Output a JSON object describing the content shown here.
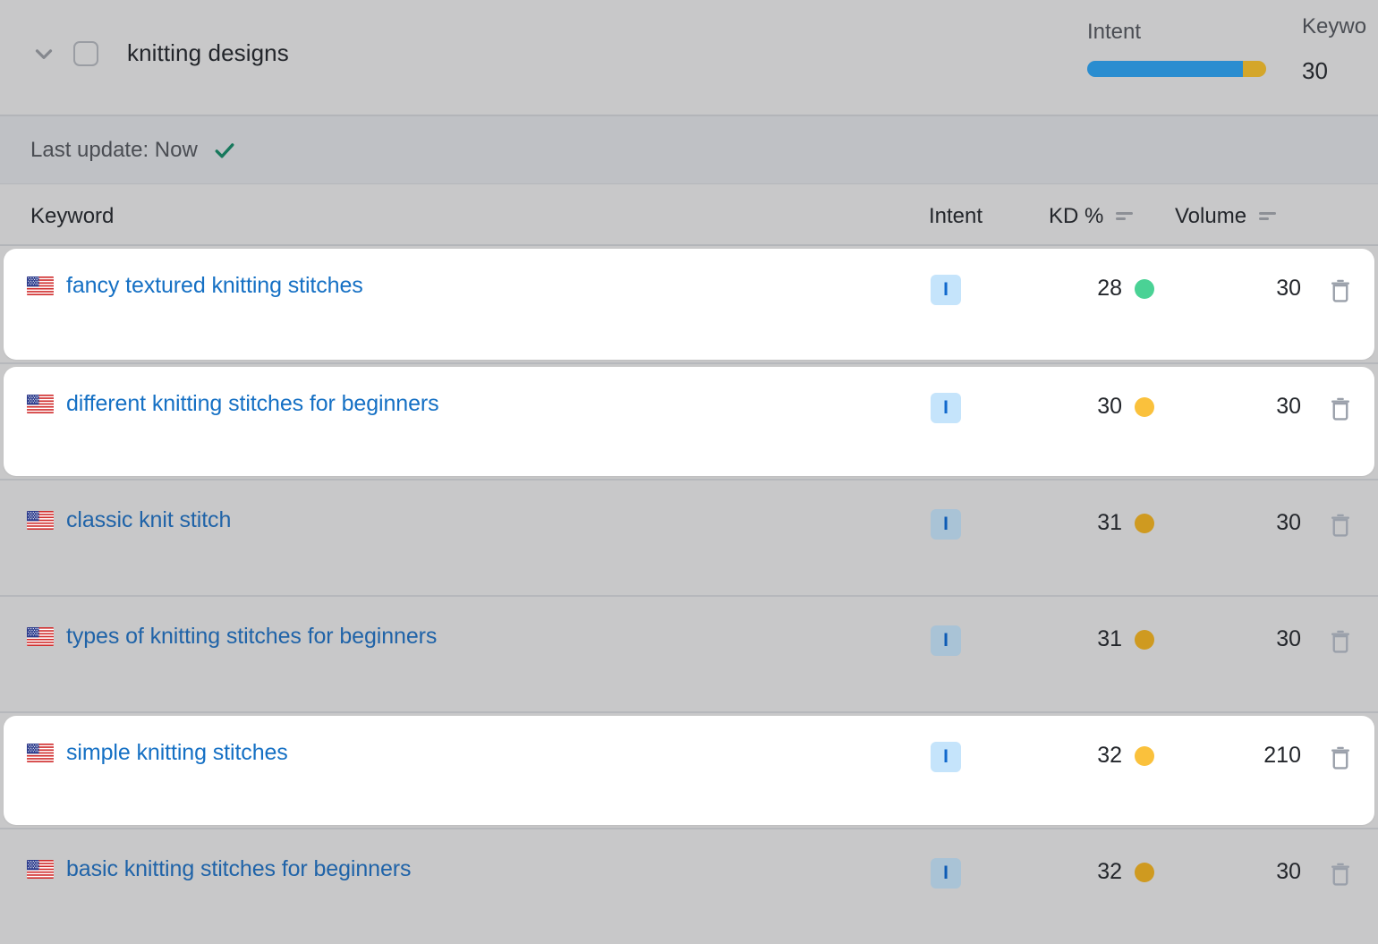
{
  "group_header": {
    "chevron_icon": "chevron-down-icon",
    "checkbox_checked": false,
    "title": "knitting designs",
    "intent_label": "Intent",
    "intent_segments": [
      {
        "name": "informational",
        "color": "#2a8dd0",
        "percent": 87
      },
      {
        "name": "commercial",
        "color": "#d4a62a",
        "percent": 13
      }
    ],
    "keywords_label": "Keywo",
    "keywords_value": "30"
  },
  "status_bar": {
    "text": "Last update: Now",
    "check_icon": "check-icon",
    "check_color": "#17785c"
  },
  "table": {
    "columns": [
      {
        "key": "keyword",
        "label": "Keyword",
        "sortable": false
      },
      {
        "key": "intent",
        "label": "Intent",
        "sortable": false
      },
      {
        "key": "kd",
        "label": "KD %",
        "sortable": true
      },
      {
        "key": "volume",
        "label": "Volume",
        "sortable": true
      }
    ],
    "rows": [
      {
        "flag": "us-flag-icon",
        "keyword": "fancy textured knitting stitches",
        "intent": "I",
        "kd": "28",
        "kd_color": "#4ad295",
        "volume": "30",
        "highlighted": true
      },
      {
        "flag": "us-flag-icon",
        "keyword": "different knitting stitches for beginners",
        "intent": "I",
        "kd": "30",
        "kd_color": "#fac13c",
        "volume": "30",
        "highlighted": true
      },
      {
        "flag": "us-flag-icon",
        "keyword": "classic knit stitch",
        "intent": "I",
        "kd": "31",
        "kd_color": "#cf9a20",
        "volume": "30",
        "highlighted": false
      },
      {
        "flag": "us-flag-icon",
        "keyword": "types of knitting stitches for beginners",
        "intent": "I",
        "kd": "31",
        "kd_color": "#cf9a20",
        "volume": "30",
        "highlighted": false
      },
      {
        "flag": "us-flag-icon",
        "keyword": "simple knitting stitches",
        "intent": "I",
        "kd": "32",
        "kd_color": "#fac13c",
        "volume": "210",
        "highlighted": true
      },
      {
        "flag": "us-flag-icon",
        "keyword": "basic knitting stitches for beginners",
        "intent": "I",
        "kd": "32",
        "kd_color": "#cf9a20",
        "volume": "30",
        "highlighted": false
      }
    ],
    "delete_icon": "trash-icon"
  }
}
